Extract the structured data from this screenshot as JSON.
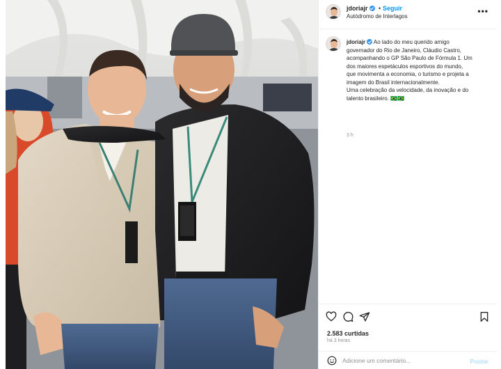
{
  "post": {
    "username": "jdoriajr",
    "separator": "•",
    "follow_label": "Seguir",
    "location": "Autódromo de Interlagos",
    "more_label": "•••",
    "caption_lines": [
      "Ao lado do meu querido amigo",
      "governador do Rio de Janeiro, Cláudio Castro,",
      "acompanhando o GP São Paulo de Fórmula 1. Um",
      "dos maiores espetáculos esportivos do mundo,",
      "que movimenta a economia, o turismo e projeta a",
      "imagem do Brasil internacionalmente.",
      "Uma celebração da velocidade, da inovação e do",
      "talento brasileiro. 🇧🇷🇧🇷"
    ],
    "caption_time": "3 h",
    "likes": "2.583 curtidas",
    "posted_ago": "há 3 horas",
    "comment_placeholder": "Adicione um comentário...",
    "post_label": "Postar"
  },
  "icons": {
    "like": "heart-icon",
    "comment": "comment-icon",
    "share": "send-icon",
    "save": "bookmark-icon",
    "emoji": "emoji-icon",
    "more": "more-options-icon",
    "verified": "verified-badge-icon"
  },
  "colors": {
    "link_blue": "#0095f6",
    "verified_blue": "#3897f0",
    "muted_text": "#8e8e8e",
    "border": "#efefef",
    "post_disabled": "#b2dffc"
  }
}
